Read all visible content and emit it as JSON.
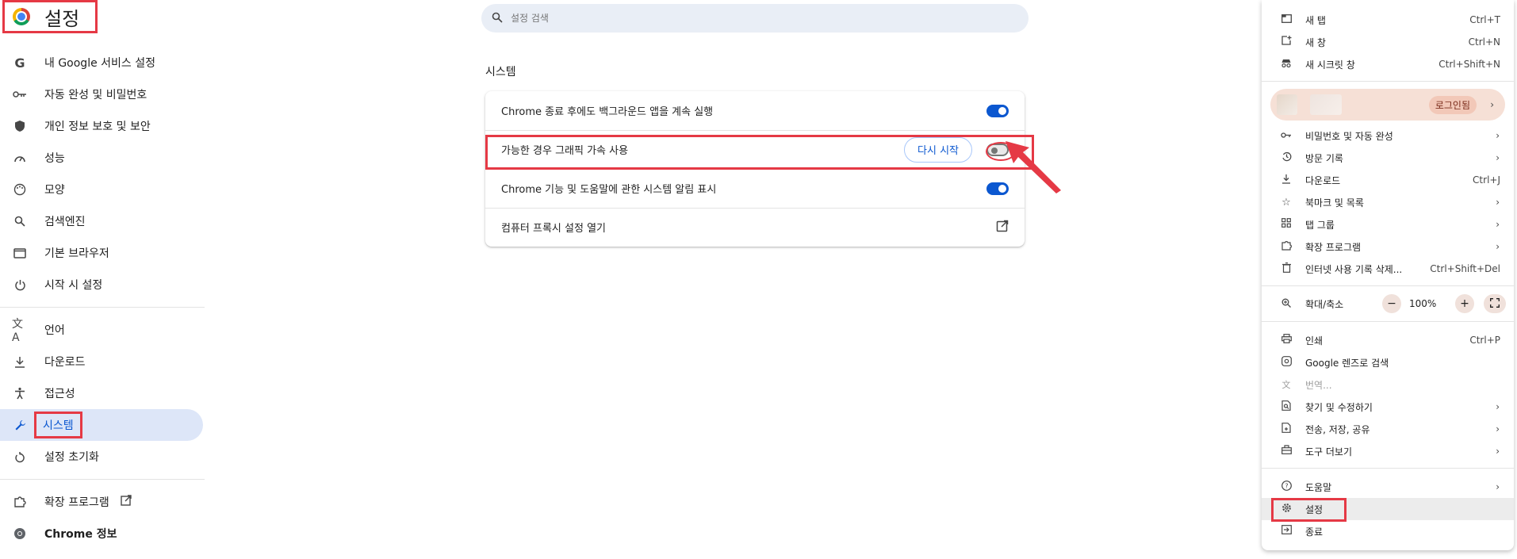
{
  "sidebar": {
    "title": "설정",
    "items": [
      {
        "label": "내 Google 서비스 설정",
        "icon": "google-g-icon"
      },
      {
        "label": "자동 완성 및 비밀번호",
        "icon": "key-icon"
      },
      {
        "label": "개인 정보 보호 및 보안",
        "icon": "shield-icon"
      },
      {
        "label": "성능",
        "icon": "speedometer-icon"
      },
      {
        "label": "모양",
        "icon": "palette-icon"
      },
      {
        "label": "검색엔진",
        "icon": "search-icon"
      },
      {
        "label": "기본 브라우저",
        "icon": "browser-window-icon"
      },
      {
        "label": "시작 시 설정",
        "icon": "power-icon"
      },
      {
        "label": "언어",
        "icon": "translate-icon"
      },
      {
        "label": "다운로드",
        "icon": "download-icon"
      },
      {
        "label": "접근성",
        "icon": "accessibility-icon"
      },
      {
        "label": "시스템",
        "icon": "wrench-icon"
      },
      {
        "label": "설정 초기화",
        "icon": "reset-icon"
      },
      {
        "label": "확장 프로그램",
        "icon": "puzzle-icon"
      },
      {
        "label": "Chrome 정보",
        "icon": "chrome-icon"
      }
    ]
  },
  "search": {
    "placeholder": "설정 검색"
  },
  "system": {
    "section_title": "시스템",
    "rows": [
      {
        "label": "Chrome 종료 후에도 백그라운드 앱을 계속 실행",
        "toggle": "on"
      },
      {
        "label": "가능한 경우 그래픽 가속 사용",
        "toggle": "off",
        "button": "다시 시작"
      },
      {
        "label": "Chrome 기능 및 도움말에 관한 시스템 알림 표시",
        "toggle": "on"
      },
      {
        "label": "컴퓨터 프록시 설정 열기",
        "icon": "open-external-icon"
      }
    ]
  },
  "menu": {
    "new_tab": {
      "label": "새 탭",
      "shortcut": "Ctrl+T"
    },
    "new_window": {
      "label": "새 창",
      "shortcut": "Ctrl+N"
    },
    "new_incognito": {
      "label": "새 시크릿 창",
      "shortcut": "Ctrl+Shift+N"
    },
    "profile_badge": "로그인됨",
    "passwords": {
      "label": "비밀번호 및 자동 완성"
    },
    "history": {
      "label": "방문 기록"
    },
    "downloads": {
      "label": "다운로드",
      "shortcut": "Ctrl+J"
    },
    "bookmarks": {
      "label": "북마크 및 목록"
    },
    "tab_groups": {
      "label": "탭 그룹"
    },
    "extensions": {
      "label": "확장 프로그램"
    },
    "clear_data": {
      "label": "인터넷 사용 기록 삭제...",
      "shortcut": "Ctrl+Shift+Del"
    },
    "zoom": {
      "label": "확대/축소",
      "value": "100%",
      "minus": "−",
      "plus": "+"
    },
    "print": {
      "label": "인쇄",
      "shortcut": "Ctrl+P"
    },
    "lens": {
      "label": "Google 렌즈로 검색"
    },
    "translate": {
      "label": "번역..."
    },
    "find_edit": {
      "label": "찾기 및 수정하기"
    },
    "cast_save_share": {
      "label": "전송, 저장, 공유"
    },
    "more_tools": {
      "label": "도구 더보기"
    },
    "help": {
      "label": "도움말"
    },
    "settings": {
      "label": "설정"
    },
    "exit": {
      "label": "종료"
    }
  },
  "colors": {
    "accent_blue": "#0b57d0",
    "active_nav_bg": "#dde6f8",
    "annotation_red": "#e53945",
    "profile_bg": "#f6e0d6"
  }
}
